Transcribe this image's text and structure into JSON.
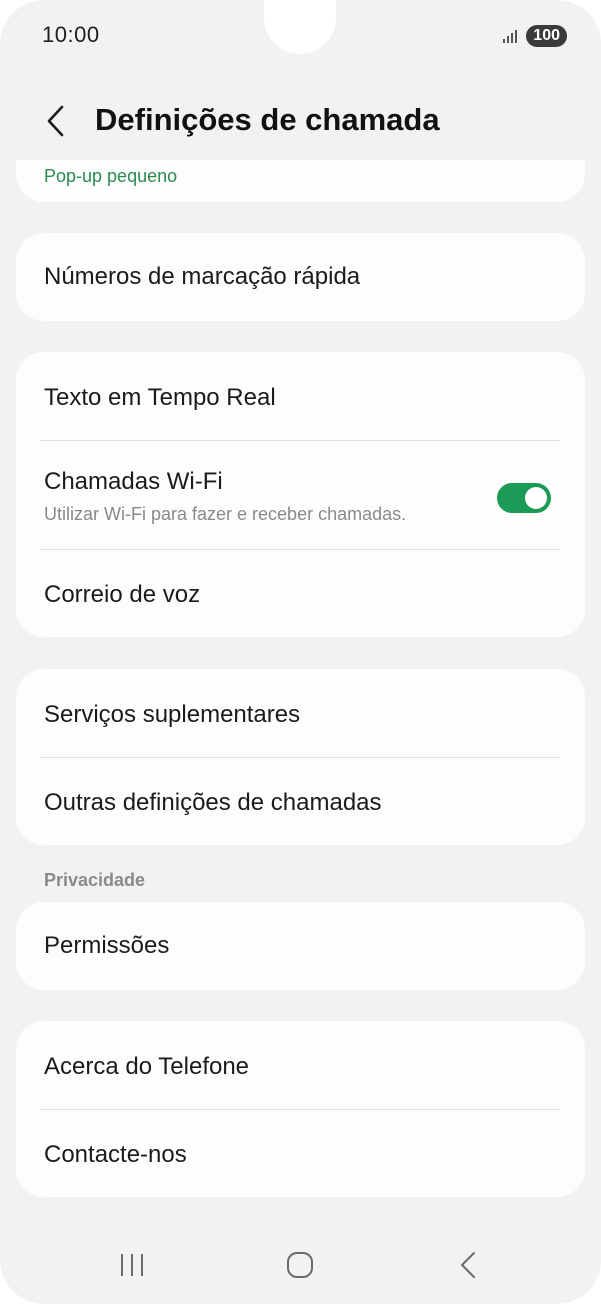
{
  "status": {
    "time": "10:00",
    "battery": "100"
  },
  "header": {
    "title": "Definições de chamada"
  },
  "partial_item": {
    "subtitle": "Pop-up pequeno"
  },
  "group1": {
    "speed_dial": "Números de marcação rápida"
  },
  "group2": {
    "rtt": "Texto em Tempo Real",
    "wifi_calling": {
      "label": "Chamadas Wi-Fi",
      "subtitle": "Utilizar Wi-Fi para fazer e receber chamadas.",
      "enabled": true
    },
    "voicemail": "Correio de voz"
  },
  "group3": {
    "supplementary": "Serviços suplementares",
    "other_settings": "Outras definições de chamadas"
  },
  "privacy": {
    "section_label": "Privacidade",
    "permissions": "Permissões"
  },
  "group5": {
    "about": "Acerca do Telefone",
    "contact": "Contacte-nos"
  },
  "colors": {
    "accent": "#1c9b57",
    "background": "#f2f2f4",
    "card": "#fdfdfe"
  },
  "icons": {
    "back": "chevron-left-icon",
    "recents": "recent-apps-icon",
    "home": "home-icon",
    "nav_back": "back-icon"
  }
}
